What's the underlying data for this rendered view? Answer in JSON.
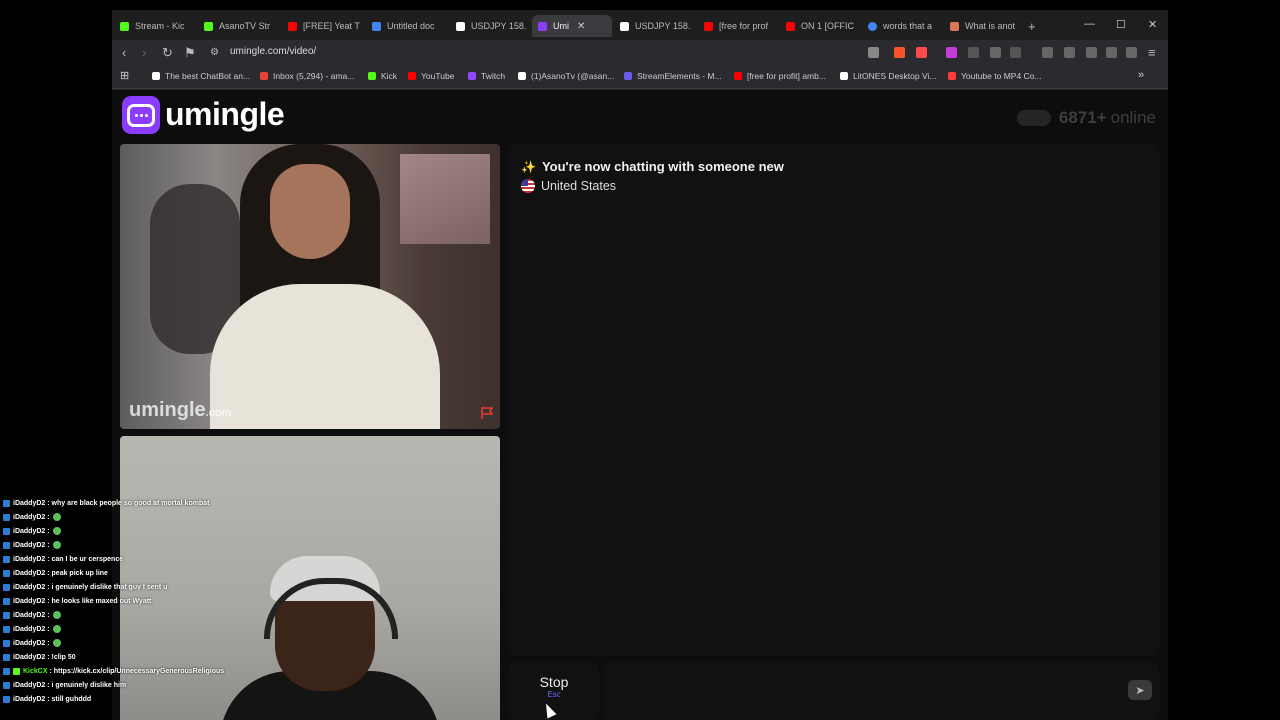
{
  "tabs": [
    {
      "label": "Stream - Kic",
      "color": "#53fc18"
    },
    {
      "label": "AsanoTV Str",
      "color": "#53fc18"
    },
    {
      "label": "[FREE] Yeat T",
      "color": "#ff0000"
    },
    {
      "label": "Untitled doc",
      "color": "#4285f4"
    },
    {
      "label": "USDJPY 158.",
      "color": "#ffffff"
    },
    {
      "label": "Umi",
      "color": "#8b3dff"
    },
    {
      "label": "USDJPY 158.",
      "color": "#ffffff"
    },
    {
      "label": "[free for prof",
      "color": "#ff0000"
    },
    {
      "label": "ON 1 [OFFIC",
      "color": "#ff0000"
    },
    {
      "label": "words that a",
      "color": "#4285f4"
    },
    {
      "label": "What is anot",
      "color": "#d97757"
    }
  ],
  "address": {
    "url": "umingle.com/video/"
  },
  "bookmarks": [
    {
      "label": "The best ChatBot an...",
      "color": "#ffffff"
    },
    {
      "label": "Inbox (5,294) - ama...",
      "color": "#ea4335"
    },
    {
      "label": "Kick",
      "color": "#53fc18"
    },
    {
      "label": "YouTube",
      "color": "#ff0000"
    },
    {
      "label": "Twitch",
      "color": "#9146ff"
    },
    {
      "label": "(1)AsanoTv (@asan...",
      "color": "#ffffff"
    },
    {
      "label": "StreamElements - M...",
      "color": "#6c5ce7"
    },
    {
      "label": "[free for profit] amb...",
      "color": "#ff0000"
    },
    {
      "label": "LitONES Desktop Vi...",
      "color": "#ffffff"
    },
    {
      "label": "Youtube to MP4 Co...",
      "color": "#ff3b3b"
    }
  ],
  "site": {
    "brand": "umingle",
    "online_count": "6871+",
    "online_label": "online",
    "watermark": "umingle",
    "watermark_suffix": ".com"
  },
  "chat": {
    "status_message": "You're now chatting with someone new",
    "country": "United States",
    "stop_label": "Stop",
    "stop_hint": "Esc",
    "input_placeholder": ""
  },
  "stream_chat": [
    {
      "user": "iDaddyD2",
      "msg": ": why are black people so good at mortal kombat",
      "emote": false,
      "color": "#ffffff"
    },
    {
      "user": "iDaddyD2",
      "msg": ":",
      "emote": true,
      "color": "#ffffff"
    },
    {
      "user": "iDaddyD2",
      "msg": ":",
      "emote": true,
      "color": "#ffffff"
    },
    {
      "user": "iDaddyD2",
      "msg": ":",
      "emote": true,
      "color": "#ffffff"
    },
    {
      "user": "iDaddyD2",
      "msg": ": can I be ur cerspence",
      "emote": false,
      "color": "#ffffff"
    },
    {
      "user": "iDaddyD2",
      "msg": ": peak pick up line",
      "emote": false,
      "color": "#ffffff"
    },
    {
      "user": "iDaddyD2",
      "msg": ": i genuinely dislike that guy I sent u",
      "emote": false,
      "color": "#ffffff"
    },
    {
      "user": "iDaddyD2",
      "msg": ": he looks like maxed out Wyatt",
      "emote": false,
      "color": "#ffffff"
    },
    {
      "user": "iDaddyD2",
      "msg": ":",
      "emote": true,
      "color": "#ffffff"
    },
    {
      "user": "iDaddyD2",
      "msg": ":",
      "emote": true,
      "color": "#ffffff"
    },
    {
      "user": "iDaddyD2",
      "msg": ":",
      "emote": true,
      "color": "#ffffff"
    },
    {
      "user": "iDaddyD2",
      "msg": ": !clip 50",
      "emote": false,
      "color": "#ffffff"
    },
    {
      "user": "KickCX",
      "msg": ": https://kick.cx/clip/UnnecessaryGenerousReligious",
      "emote": false,
      "color": "#53fc18"
    },
    {
      "user": "iDaddyD2",
      "msg": ": i genuinely dislike him",
      "emote": false,
      "color": "#ffffff"
    },
    {
      "user": "iDaddyD2",
      "msg": ": still guhddd",
      "emote": false,
      "color": "#ffffff"
    }
  ]
}
